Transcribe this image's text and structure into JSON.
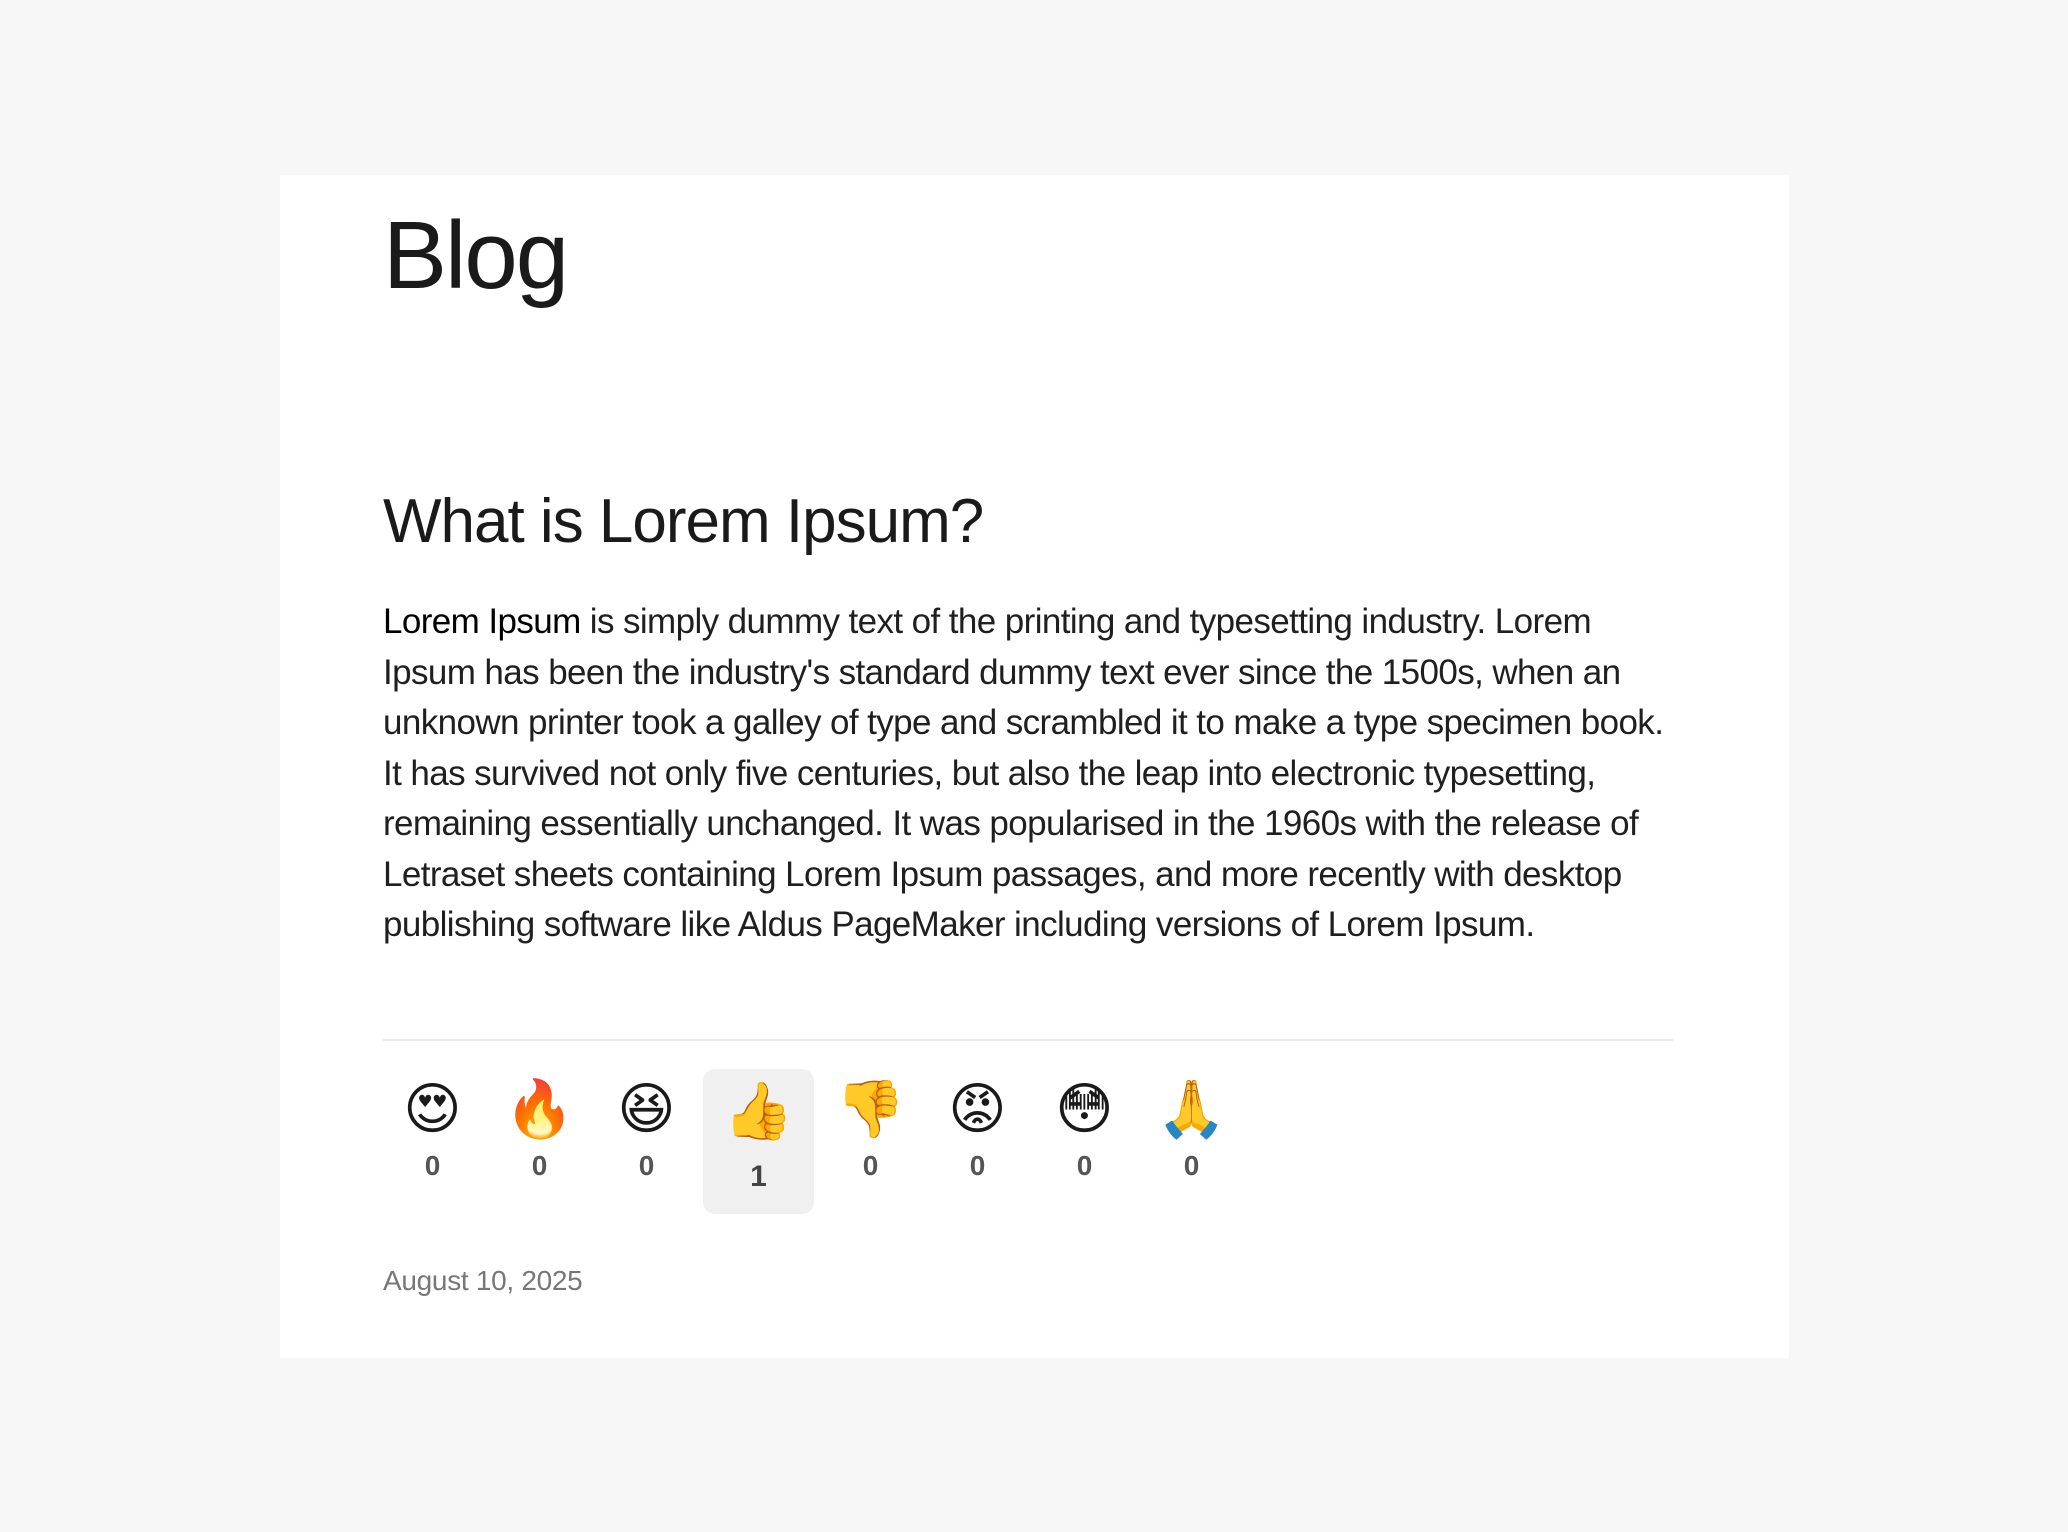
{
  "page": {
    "title": "Blog"
  },
  "post": {
    "title": "What is Lorem Ipsum?",
    "body_strong": "Lorem Ipsum",
    "body_text": " is simply dummy text of the printing and typesetting industry. Lorem Ipsum has been the industry's standard dummy text ever since the 1500s, when an unknown printer took a galley of type and scrambled it to make a type specimen book. It has survived not only five centuries, but also the leap into electronic typesetting, remaining essentially unchanged. It was popularised in the 1960s with the release of Letraset sheets containing Lorem Ipsum passages, and more recently with desktop publishing software like Aldus PageMaker including versions of Lorem Ipsum.",
    "date": "August 10, 2025"
  },
  "reactions": [
    {
      "icon": "heart-eyes-icon",
      "emoji": "😍",
      "count": "0",
      "active": false
    },
    {
      "icon": "fire-icon",
      "emoji": "🔥",
      "count": "0",
      "active": false
    },
    {
      "icon": "laughing-face-icon",
      "emoji": "😆",
      "count": "0",
      "active": false
    },
    {
      "icon": "thumbs-up-icon",
      "emoji": "👍",
      "count": "1",
      "active": true
    },
    {
      "icon": "thumbs-down-icon",
      "emoji": "👎",
      "count": "0",
      "active": false
    },
    {
      "icon": "angry-face-icon",
      "emoji": "😡",
      "count": "0",
      "active": false
    },
    {
      "icon": "astonished-face-icon",
      "emoji": "😳",
      "count": "0",
      "active": false
    },
    {
      "icon": "folded-hands-icon",
      "emoji": "🙏",
      "count": "0",
      "active": false
    }
  ],
  "colors": {
    "page_background": "#f7f7f7",
    "card_background": "#ffffff",
    "active_reaction_background": "#f0f0f0"
  }
}
